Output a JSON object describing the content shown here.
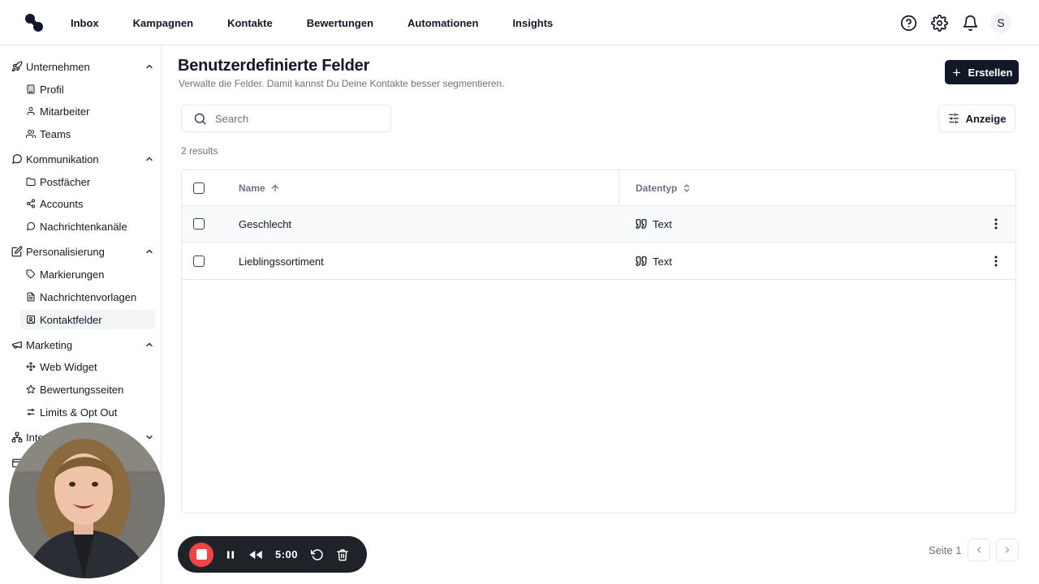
{
  "nav": {
    "items": [
      "Inbox",
      "Kampagnen",
      "Kontakte",
      "Bewertungen",
      "Automationen",
      "Insights"
    ],
    "avatar_initial": "S",
    "icons": [
      "help-icon",
      "gear-icon",
      "bell-icon"
    ]
  },
  "sidebar": {
    "sections": [
      {
        "label": "Unternehmen",
        "icon": "rocket-icon",
        "items": [
          {
            "label": "Profil",
            "icon": "building-icon"
          },
          {
            "label": "Mitarbeiter",
            "icon": "user-icon"
          },
          {
            "label": "Teams",
            "icon": "users-icon"
          }
        ]
      },
      {
        "label": "Kommunikation",
        "icon": "message-circle-icon",
        "items": [
          {
            "label": "Postfächer",
            "icon": "folder-icon"
          },
          {
            "label": "Accounts",
            "icon": "share-icon"
          },
          {
            "label": "Nachrichtenkanäle",
            "icon": "message-circle-icon"
          }
        ]
      },
      {
        "label": "Personalisierung",
        "icon": "edit-icon",
        "items": [
          {
            "label": "Markierungen",
            "icon": "tag-icon"
          },
          {
            "label": "Nachrichtenvorlagen",
            "icon": "file-text-icon"
          },
          {
            "label": "Kontaktfelder",
            "icon": "contact-icon",
            "active": true
          }
        ]
      },
      {
        "label": "Marketing",
        "icon": "megaphone-icon",
        "items": [
          {
            "label": "Web Widget",
            "icon": "move-icon"
          },
          {
            "label": "Bewertungsseiten",
            "icon": "star-icon"
          },
          {
            "label": "Limits & Opt Out",
            "icon": "sliders-icon"
          }
        ]
      },
      {
        "label": "Inte",
        "icon": "network-icon",
        "items": []
      }
    ]
  },
  "main": {
    "title": "Benutzerdefinierte Felder",
    "subtitle": "Verwalte die Felder. Damit kannst Du Deine Kontakte besser segmentieren.",
    "create_label": "Erstellen",
    "search_placeholder": "Search",
    "view_label": "Anzeige",
    "results_text": "2 results",
    "table": {
      "columns": [
        "Name",
        "Datentyp"
      ],
      "rows": [
        {
          "name": "Geschlecht",
          "type": "Text"
        },
        {
          "name": "Lieblingssortiment",
          "type": "Text"
        }
      ]
    },
    "pagination": {
      "label": "Seite 1"
    }
  },
  "recorder": {
    "time": "5:00"
  }
}
